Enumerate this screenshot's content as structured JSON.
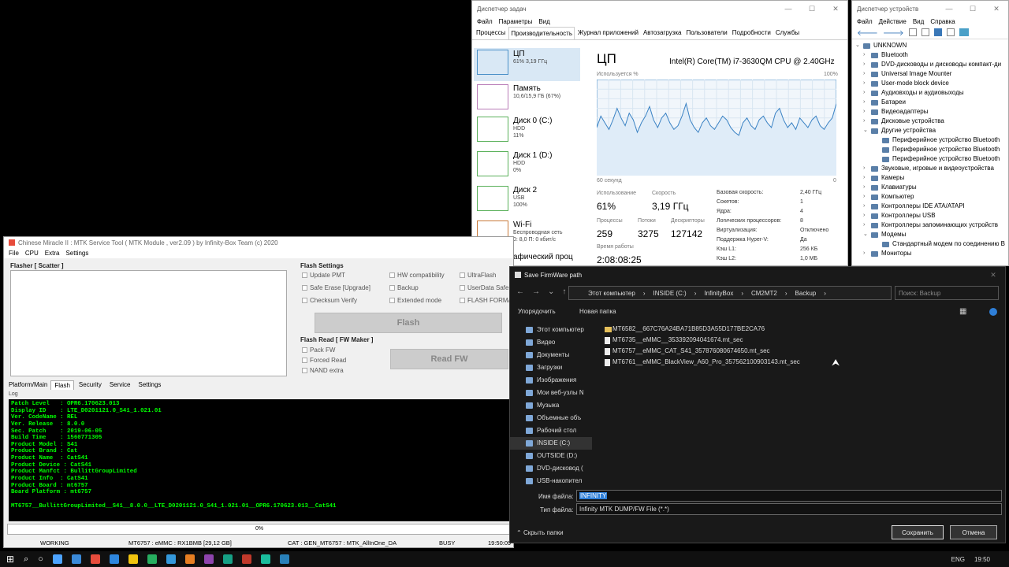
{
  "task_manager": {
    "title": "Диспетчер задач",
    "menu": [
      "Файл",
      "Параметры",
      "Вид"
    ],
    "tabs": [
      "Процессы",
      "Производительность",
      "Журнал приложений",
      "Автозагрузка",
      "Пользователи",
      "Подробности",
      "Службы"
    ],
    "resources": [
      {
        "name": "ЦП",
        "sub": "61% 3,19 ГГц"
      },
      {
        "name": "Память",
        "sub": "10,6/15,9 ГБ (67%)"
      },
      {
        "name": "Диск 0 (C:)",
        "sub": "HDD",
        "sub2": "11%"
      },
      {
        "name": "Диск 1 (D:)",
        "sub": "HDD",
        "sub2": "0%"
      },
      {
        "name": "Диск 2",
        "sub": "USB",
        "sub2": "100%"
      },
      {
        "name": "Wi-Fi",
        "sub": "Беспроводная сеть",
        "sub2": "0: 8,0 П: 0 кбит/с"
      },
      {
        "name": "афический проц",
        "sub": ""
      }
    ],
    "cpu": {
      "heading": "ЦП",
      "model": "Intel(R) Core(TM) i7-3630QM CPU @ 2.40GHz",
      "graph_label": "Используется %",
      "graph_max": "100%",
      "graph_time": "60 секунд",
      "graph_min": "0",
      "usage_label": "Использование",
      "usage": "61%",
      "speed_label": "Скорость",
      "speed": "3,19 ГГц",
      "proc_label": "Процессы",
      "proc": "259",
      "threads_label": "Потоки",
      "threads": "3275",
      "handles_label": "Дескрипторы",
      "handles": "127142",
      "uptime_label": "Время работы",
      "uptime": "2:08:08:25",
      "specs": [
        [
          "Базовая скорость:",
          "2,40 ГГц"
        ],
        [
          "Сокетов:",
          "1"
        ],
        [
          "Ядра:",
          "4"
        ],
        [
          "Логических процессоров:",
          "8"
        ],
        [
          "Виртуализация:",
          "Отключено"
        ],
        [
          "Поддержка Hyper-V:",
          "Да"
        ],
        [
          "Кэш L1:",
          "256 КБ"
        ],
        [
          "Кэш L2:",
          "1,0 МБ"
        ]
      ],
      "series": [
        50,
        62,
        55,
        48,
        58,
        70,
        60,
        52,
        65,
        58,
        45,
        55,
        62,
        72,
        58,
        50,
        60,
        65,
        55,
        48,
        52,
        62,
        75,
        58,
        50,
        45,
        55,
        60,
        52,
        48,
        55,
        62,
        58,
        50,
        45,
        42,
        55,
        60,
        52,
        48,
        58,
        62,
        55,
        50,
        65,
        70,
        58,
        50,
        55,
        48,
        60,
        55,
        50,
        58,
        62,
        52,
        48,
        55,
        60,
        75
      ]
    }
  },
  "device_manager": {
    "title": "Диспетчер устройств",
    "menu": [
      "Файл",
      "Действие",
      "Вид",
      "Справка"
    ],
    "root": "UNKNOWN",
    "items": [
      "Bluetooth",
      "DVD-дисководы и дисководы компакт-ди",
      "Universal Image Mounter",
      "User-mode block device",
      "Аудиовходы и аудиовыходы",
      "Батареи",
      "Видеоадаптеры",
      "Дисковые устройства",
      "Другие устройства",
      "Периферийное устройство Bluetooth",
      "Периферийное устройство Bluetooth",
      "Периферийное устройство Bluetooth",
      "Звуковые, игровые и видеоустройства",
      "Камеры",
      "Клавиатуры",
      "Компьютер",
      "Контроллеры IDE ATA/ATAPI",
      "Контроллеры USB",
      "Контроллеры запоминающих устройств",
      "Модемы",
      "Стандартный модем по соединению B",
      "Мониторы"
    ]
  },
  "mtk": {
    "title": "Chinese Miracle II : MTK Service Tool ( MTK Module , ver2.09 ) by Infinity-Box Team (c) 2020",
    "menu": [
      "File",
      "CPU",
      "Extra",
      "Settings"
    ],
    "flasher_label": "Flasher [ Scatter ]",
    "flash_settings_label": "Flash Settings",
    "checks": [
      "Update PMT",
      "HW compatibility",
      "UltraFlash",
      "Safe Erase [Upgrade]",
      "Backup",
      "UserData Safe",
      "Checksum Verify",
      "Extended mode",
      "FLASH FORMAT"
    ],
    "flash_btn": "Flash",
    "read_label": "Flash Read [ FW Maker ]",
    "read_checks": [
      "Pack FW",
      "Forced Read",
      "NAND extra"
    ],
    "read_btn": "Read FW",
    "tabs": [
      "Platform/Main",
      "Flash",
      "Security",
      "Service",
      "Settings"
    ],
    "log_label": "Log",
    "log_lines": [
      "Patch Level   : OPR6.170623.013",
      "Display ID    : LTE_D0201121.0_S41_1.021.01",
      "Ver. CodeName : REL",
      "Ver. Release  : 8.0.0",
      "Sec. Patch    : 2019-06-05",
      "Build Time    : 1560771305",
      "Product Model : S41",
      "Product Brand : Cat",
      "Product Name  : CatS41",
      "Product Device : CatS41",
      "Product Manfct : BullittGroupLimited",
      "Product Info  : CatS41",
      "Product Board : mt6757",
      "Board Platform : mt6757",
      "",
      "MT6757__BullittGroupLimited__S41__8.0.0__LTE_D0201121.0_S41_1.021.01__OPR6.170623.013__CatS41"
    ],
    "progress": "0%",
    "status": [
      "WORKING",
      "MT6757 : eMMC : RX1BMB [29,12 GB]",
      "CAT : GEN_MT6757 : MTK_AllInOne_DA",
      "BUSY",
      "19:50:09"
    ]
  },
  "save_dialog": {
    "title": "Save FirmWare path",
    "path": [
      "Этот компьютер",
      "INSIDE (C:)",
      "InfinityBox",
      "CM2MT2",
      "Backup"
    ],
    "search_placeholder": "Поиск: Backup",
    "organize": "Упорядочить",
    "new_folder": "Новая папка",
    "nav": [
      "Этот компьютер",
      "Видео",
      "Документы",
      "Загрузки",
      "Изображения",
      "Мои веб-узлы N",
      "Музыка",
      "Объемные объ",
      "Рабочий стол",
      "INSIDE (C:)",
      "OUTSIDE (D:)",
      "DVD-дисковод (",
      "USB-накопител"
    ],
    "files": [
      {
        "name": "MT6582__667C76A24BA71B85D3A55D177BE2CA76",
        "folder": true
      },
      {
        "name": "MT6735__eMMC__353392094041674.mt_sec",
        "folder": false
      },
      {
        "name": "MT6757__eMMC_CAT_S41_357876080674650.mt_sec",
        "folder": false
      },
      {
        "name": "MT6761__eMMC_BlackView_A60_Pro_357562100903143.mt_sec",
        "folder": false
      }
    ],
    "filename_label": "Имя файла:",
    "filename": "INFINITY",
    "filetype_label": "Тип файла:",
    "filetype": "Infinity MTK DUMP/FW File (*.*)",
    "hide_folders": "Скрыть папки",
    "save_btn": "Сохранить",
    "cancel_btn": "Отмена"
  },
  "taskbar": {
    "lang": "ENG",
    "time": "19:50",
    "colors": [
      "#4da3ff",
      "#3b8ad9",
      "#e74c3c",
      "#2e86de",
      "#f1c40f",
      "#27ae60",
      "#3498db",
      "#e67e22",
      "#8e44ad",
      "#16a085",
      "#c0392b",
      "#1abc9c",
      "#2980b9"
    ]
  }
}
